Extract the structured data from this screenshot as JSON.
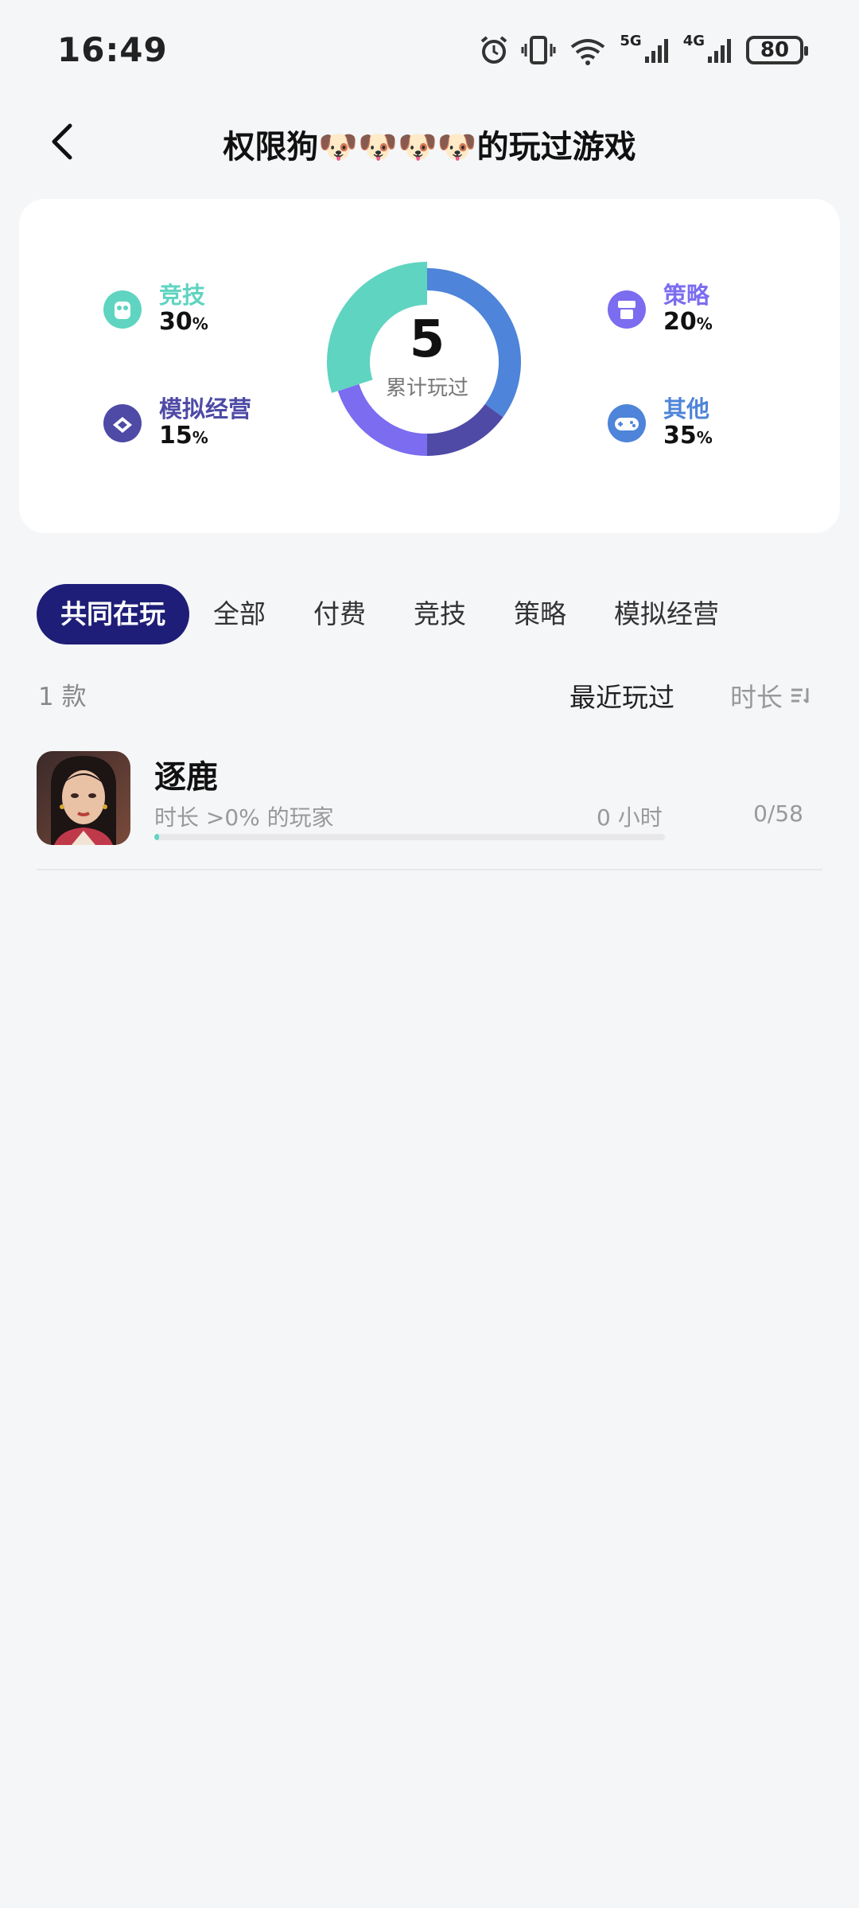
{
  "status_bar": {
    "time": "16:49",
    "battery": "80",
    "net1": "5G",
    "net2": "4G"
  },
  "header": {
    "title": "权限狗🐶🐶🐶🐶的玩过游戏"
  },
  "summary": {
    "total": "5",
    "total_label": "累计玩过",
    "categories": [
      {
        "name": "竞技",
        "pct": "30",
        "unit": "%",
        "color": "#5fd4c0",
        "icon": "competitive-icon"
      },
      {
        "name": "模拟经营",
        "pct": "15",
        "unit": "%",
        "color": "#4e4aa6",
        "icon": "simulation-icon"
      },
      {
        "name": "策略",
        "pct": "20",
        "unit": "%",
        "color": "#7b6cf0",
        "icon": "strategy-icon"
      },
      {
        "name": "其他",
        "pct": "35",
        "unit": "%",
        "color": "#4e84d9",
        "icon": "gamepad-icon"
      }
    ]
  },
  "tabs": [
    {
      "label": "共同在玩",
      "active": true
    },
    {
      "label": "全部"
    },
    {
      "label": "付费"
    },
    {
      "label": "竞技"
    },
    {
      "label": "策略"
    },
    {
      "label": "模拟经营"
    }
  ],
  "list": {
    "count": "1 款",
    "sort_recent": "最近玩过",
    "sort_duration": "时长",
    "games": [
      {
        "name": "逐鹿",
        "subtitle": "时长 >0% 的玩家",
        "hours": "0 小时",
        "rank": "0/58",
        "progress": 0.01
      }
    ]
  },
  "colors": {
    "accent": "#1e1e78",
    "background": "#f5f6f8"
  }
}
